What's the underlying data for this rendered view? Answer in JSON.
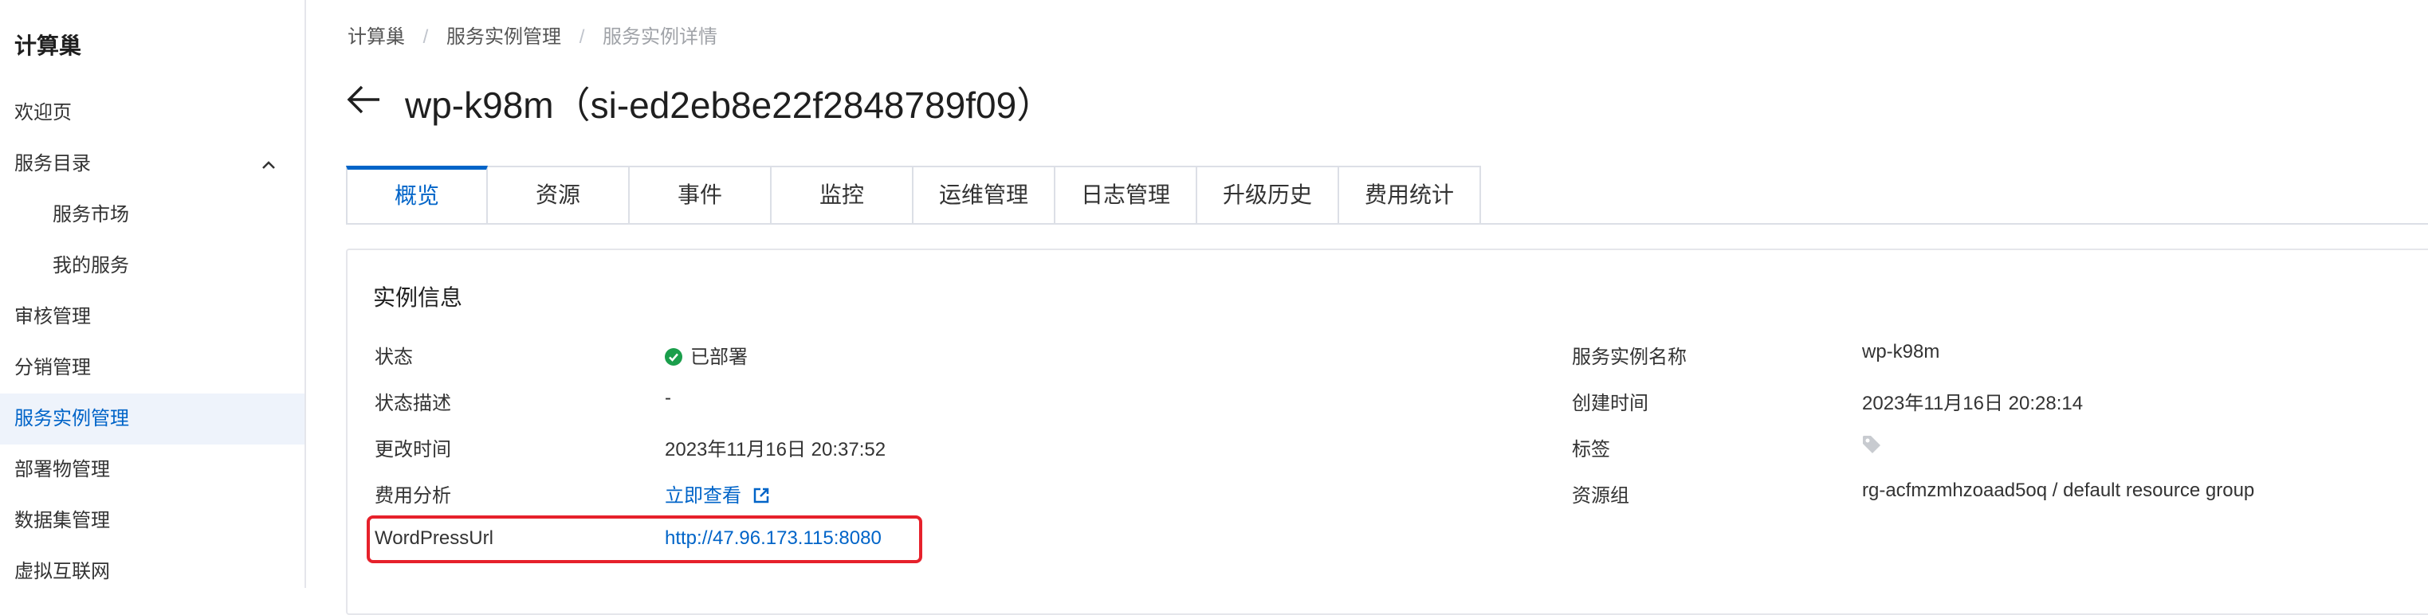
{
  "sidebar": {
    "title": "计算巢",
    "items": [
      {
        "label": "欢迎页"
      },
      {
        "label": "服务目录"
      },
      {
        "label": "服务市场"
      },
      {
        "label": "我的服务"
      },
      {
        "label": "审核管理"
      },
      {
        "label": "分销管理"
      },
      {
        "label": "服务实例管理"
      },
      {
        "label": "部署物管理"
      },
      {
        "label": "数据集管理"
      },
      {
        "label": "虚拟互联网"
      }
    ],
    "active_item": "服务实例管理"
  },
  "breadcrumb": {
    "items": [
      "计算巢",
      "服务实例管理",
      "服务实例详情"
    ],
    "separator": "/"
  },
  "header": {
    "title": "wp-k98m（si-ed2eb8e22f2848789f09）"
  },
  "tabs": [
    {
      "label": "概览"
    },
    {
      "label": "资源"
    },
    {
      "label": "事件"
    },
    {
      "label": "监控"
    },
    {
      "label": "运维管理"
    },
    {
      "label": "日志管理"
    },
    {
      "label": "升级历史"
    },
    {
      "label": "费用统计"
    }
  ],
  "active_tab": "概览",
  "instance_info": {
    "title": "实例信息",
    "left": [
      {
        "label": "状态",
        "value": "已部署"
      },
      {
        "label": "状态描述",
        "value": "-"
      },
      {
        "label": "更改时间",
        "value": "2023年11月16日 20:37:52"
      },
      {
        "label": "费用分析",
        "value": "立即查看"
      },
      {
        "label": "WordPressUrl",
        "value": "http://47.96.173.115:8080"
      }
    ],
    "right": [
      {
        "label": "服务实例名称",
        "value": "wp-k98m"
      },
      {
        "label": "创建时间",
        "value": "2023年11月16日 20:28:14"
      },
      {
        "label": "标签",
        "value": ""
      },
      {
        "label": "资源组",
        "value": "rg-acfmzmhzoaad5oq / default resource group"
      }
    ]
  },
  "colors": {
    "accent": "#0064c8",
    "status_ok": "#1a9e4b",
    "highlight": "#e6212b",
    "active_bg": "#eef3fb"
  },
  "icons": {
    "back": "arrow-left-icon",
    "collapse": "chevron-up-icon",
    "status": "check-circle-icon",
    "external": "external-link-icon",
    "tag": "tag-icon"
  }
}
